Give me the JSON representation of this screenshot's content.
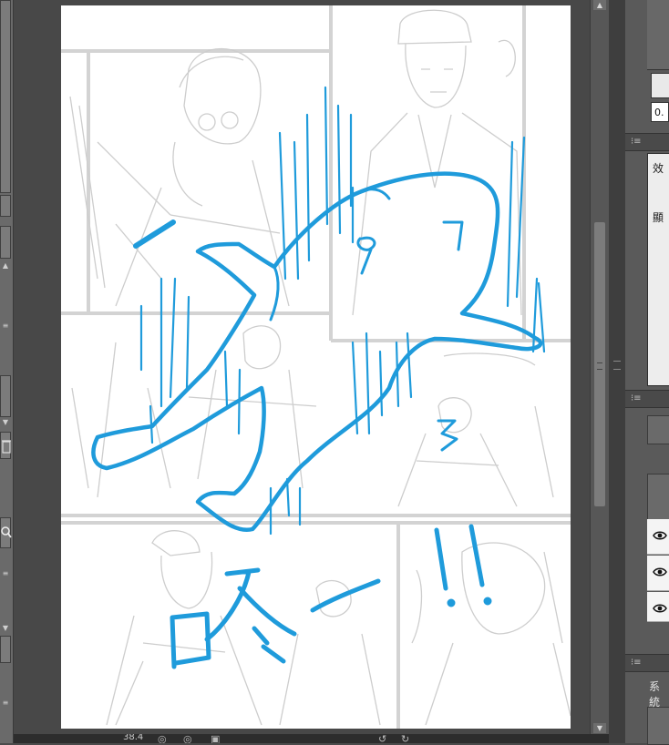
{
  "canvas": {
    "sfx_text": "咚",
    "exclamation": "!!"
  },
  "right_panel": {
    "value_field": "0.",
    "section_text_1": "效",
    "section_text_2": "顯",
    "bottom_label": "系統"
  },
  "status_bar": {
    "zoom_text": "38.4"
  },
  "colors": {
    "ink_blue": "#1f9bdb",
    "sketch_gray": "#c9c9c9",
    "canvas_bg": "#484848",
    "panel_bg": "#5a5a5a"
  },
  "icons": {
    "scroll_up": "▲",
    "scroll_down": "▼",
    "eye": "eye-icon",
    "left_tools": [
      "trash-icon",
      "magnifier-icon",
      "eraser-icon"
    ]
  }
}
